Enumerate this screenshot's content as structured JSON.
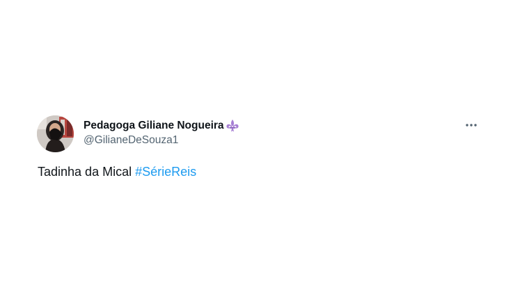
{
  "author": {
    "display_name": "Pedagoga Giliane Nogueira",
    "handle": "@GilianeDeSouza1",
    "name_emoji": "fleur-de-lis-icon",
    "avatar": "avatar-photo"
  },
  "tweet": {
    "text": "Tadinha da Mical",
    "hashtag": "#SérieReis"
  },
  "actions": {
    "more_icon": "more-horizontal-icon"
  },
  "colors": {
    "name": "#0f1419",
    "handle": "#536471",
    "hashtag": "#1d9bf0",
    "emoji": "#a77fd4"
  }
}
